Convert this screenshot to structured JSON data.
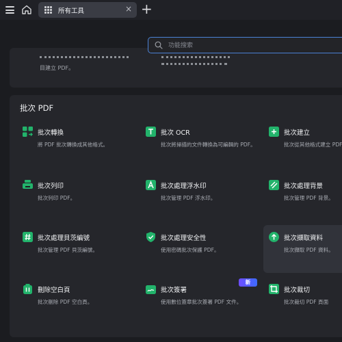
{
  "tab": {
    "label": "所有工具",
    "close": "×"
  },
  "search": {
    "placeholder": "功能搜索"
  },
  "top_card": {
    "col1_line2": "目建立 PDF。"
  },
  "section": {
    "title": "批次 PDF"
  },
  "tools": [
    {
      "title": "批次轉換",
      "desc": "將 PDF 批次轉換成其他格式。",
      "icon": "convert-icon",
      "color": "#22b36b"
    },
    {
      "title": "批次 OCR",
      "desc": "批次將掃描的文件轉換為可編輯的 PDF。",
      "icon": "ocr-icon",
      "color": "#22b36b"
    },
    {
      "title": "批次建立",
      "desc": "批次從其他格式建立 PDF",
      "icon": "create-icon",
      "color": "#22b36b"
    },
    {
      "title": "批次列印",
      "desc": "批次列印 PDF。",
      "icon": "print-icon",
      "color": "#22b36b"
    },
    {
      "title": "批次處理浮水印",
      "desc": "批次管理 PDF 浮水印。",
      "icon": "watermark-icon",
      "color": "#22b36b"
    },
    {
      "title": "批次處理背景",
      "desc": "批次管理 PDF 背景。",
      "icon": "background-icon",
      "color": "#22b36b"
    },
    {
      "title": "批次處理貝茨編號",
      "desc": "批次管理 PDF 貝茨編號。",
      "icon": "bates-icon",
      "color": "#22b36b"
    },
    {
      "title": "批次處理安全性",
      "desc": "使用密碼批次保護 PDF。",
      "icon": "shield-icon",
      "color": "#22b36b"
    },
    {
      "title": "批次擷取資料",
      "desc": "批次擷取 PDF 資料。",
      "icon": "extract-icon",
      "color": "#22b36b"
    },
    {
      "title": "刪除空白頁",
      "desc": "批次刪除 PDF 空白頁。",
      "icon": "delete-blank-icon",
      "color": "#22b36b"
    },
    {
      "title": "批次簽署",
      "desc": "使用數位簽章批次簽署 PDF 文件。",
      "icon": "sign-icon",
      "color": "#22b36b",
      "badge": "新"
    },
    {
      "title": "批次裁切",
      "desc": "批次裁切 PDF 頁面",
      "icon": "crop-icon",
      "color": "#22b36b"
    }
  ]
}
